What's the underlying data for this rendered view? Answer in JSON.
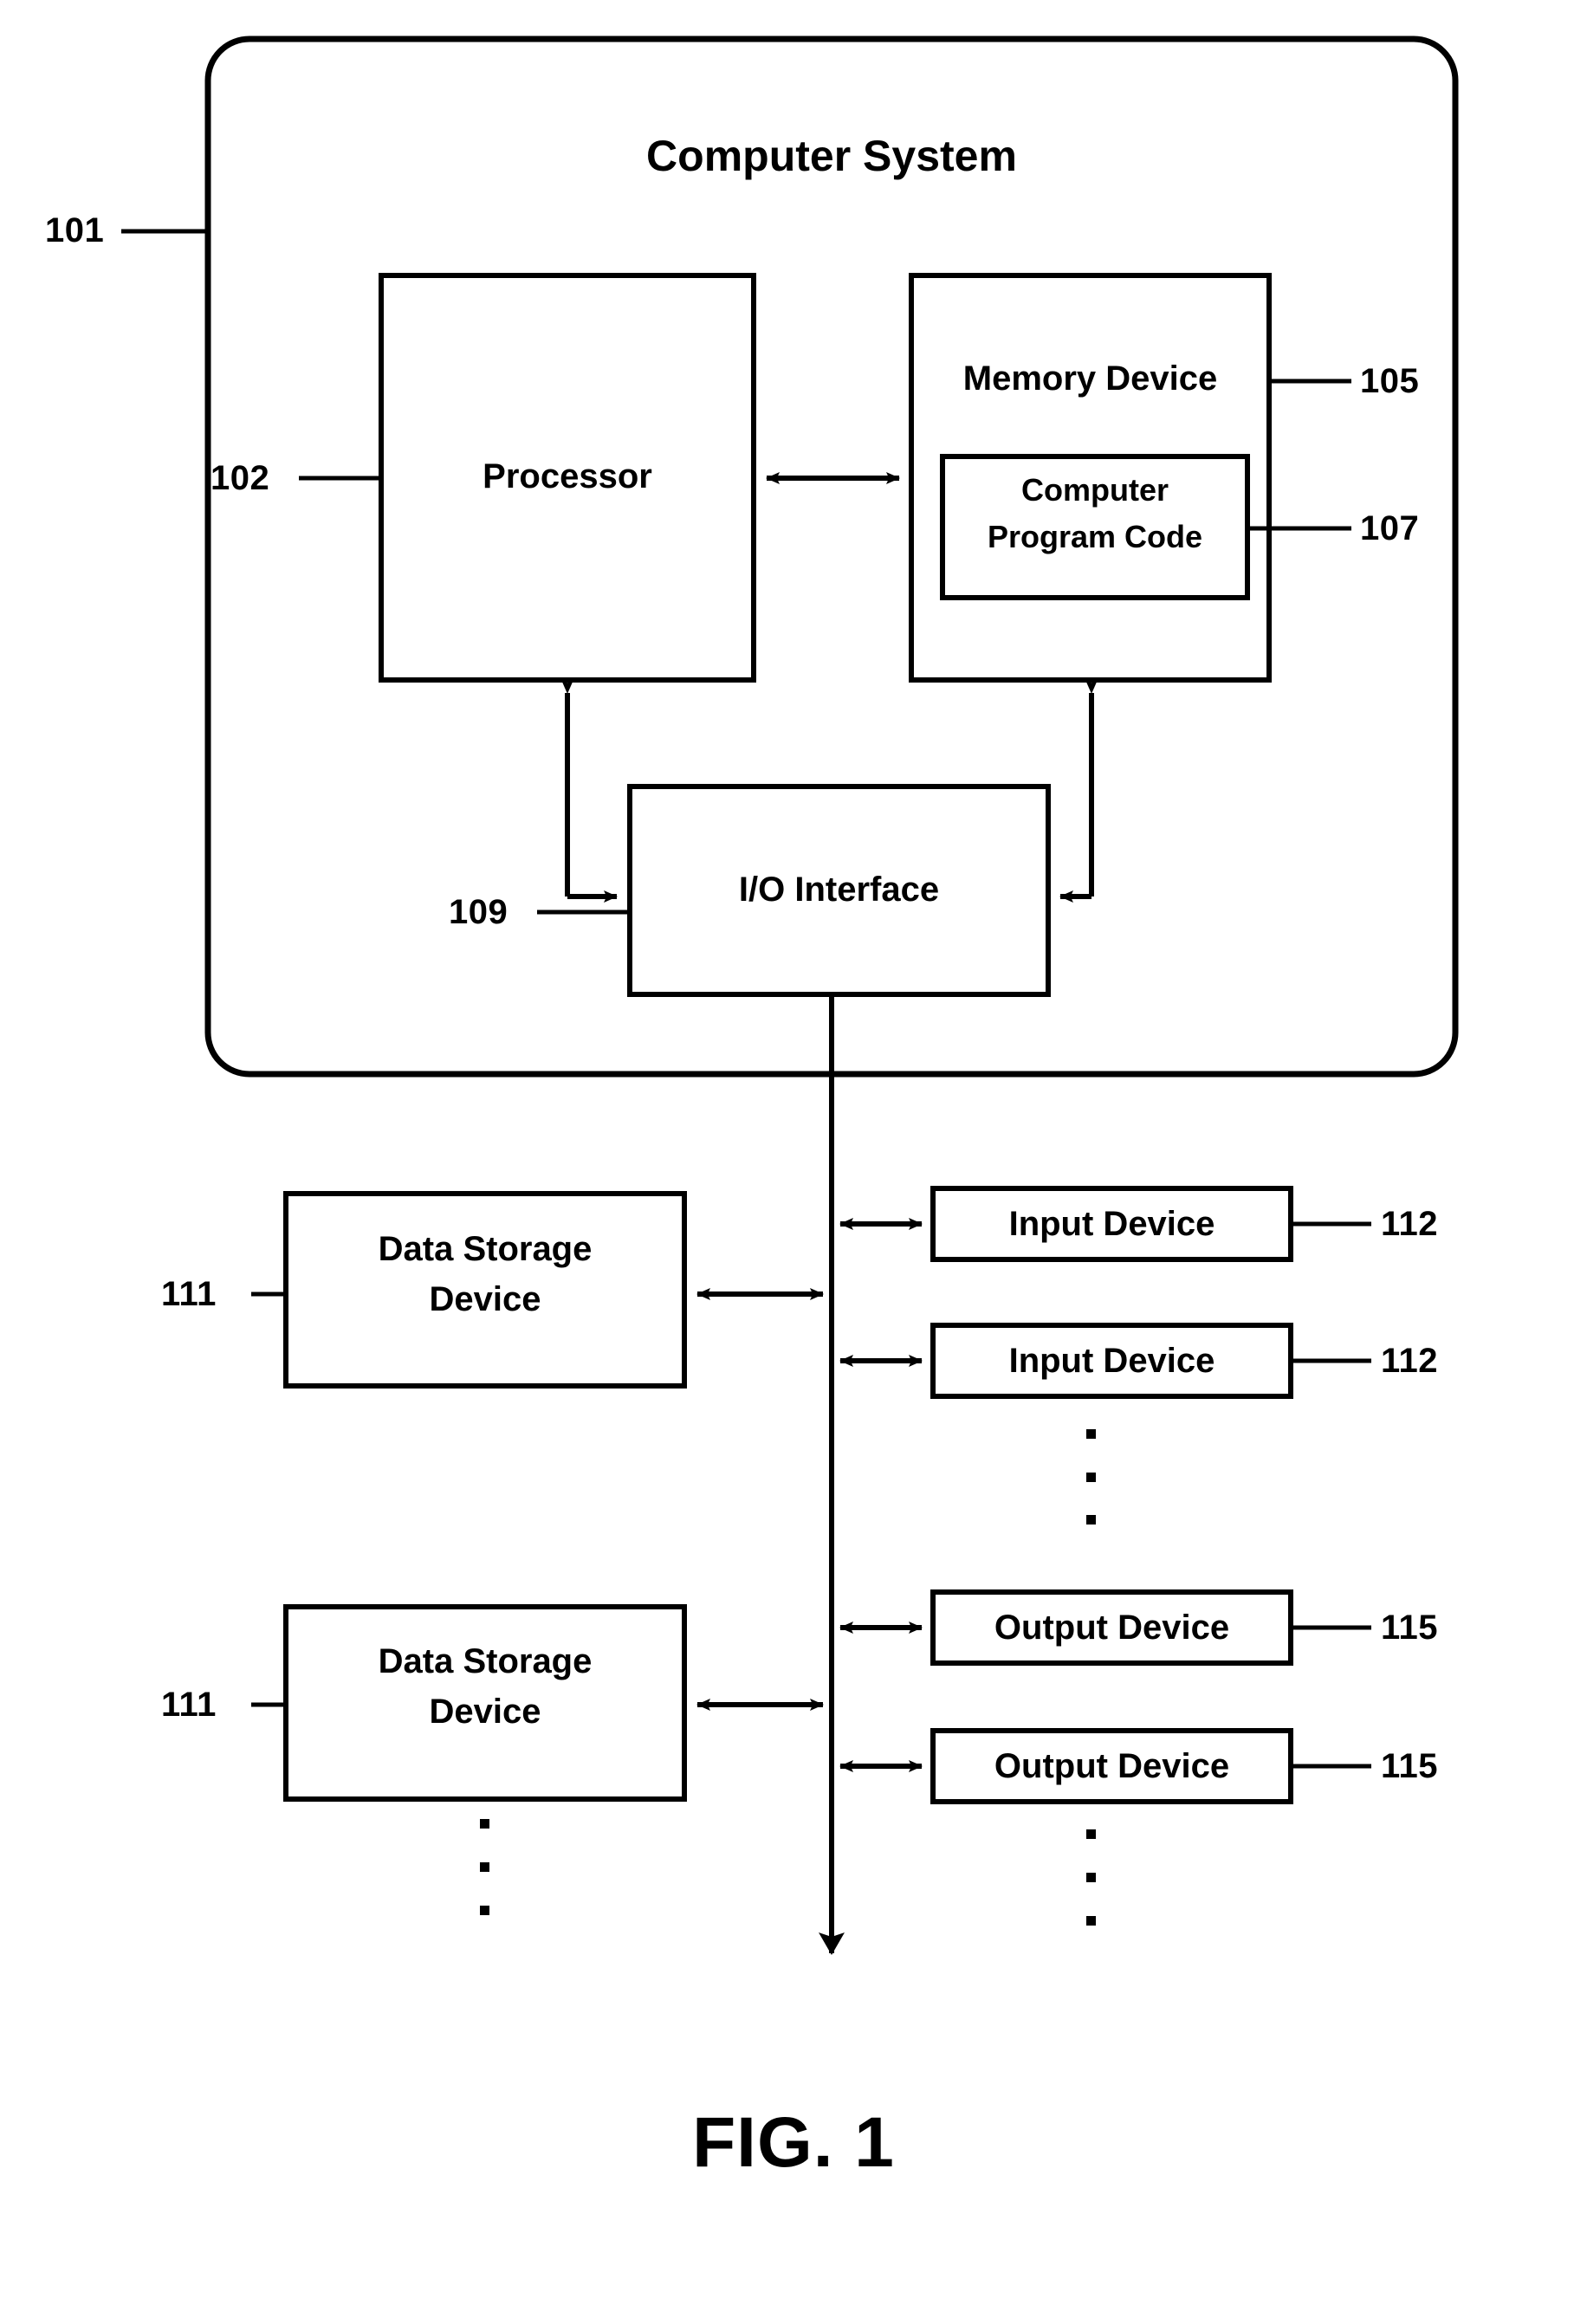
{
  "figure": {
    "caption": "FIG. 1",
    "system": {
      "title": "Computer System",
      "ref": "101"
    },
    "blocks": {
      "processor": {
        "label": "Processor",
        "ref": "102"
      },
      "memory_device": {
        "label": "Memory Device",
        "ref": "105"
      },
      "computer_program_code": {
        "label_line1": "Computer",
        "label_line2": "Program Code",
        "ref": "107"
      },
      "io_interface": {
        "label": "I/O Interface",
        "ref": "109"
      },
      "data_storage_device_1": {
        "label_line1": "Data Storage",
        "label_line2": "Device",
        "ref": "111"
      },
      "data_storage_device_2": {
        "label_line1": "Data Storage",
        "label_line2": "Device",
        "ref": "111"
      },
      "input_device_1": {
        "label": "Input Device",
        "ref": "112"
      },
      "input_device_2": {
        "label": "Input Device",
        "ref": "112"
      },
      "output_device_1": {
        "label": "Output Device",
        "ref": "115"
      },
      "output_device_2": {
        "label": "Output Device",
        "ref": "115"
      }
    },
    "ellipses": {
      "input_devices": "⋮",
      "output_devices": "⋮",
      "data_storage_devices": "⋮"
    },
    "colors": {
      "stroke": "#000000",
      "background": "#ffffff",
      "text": "#000000"
    }
  }
}
